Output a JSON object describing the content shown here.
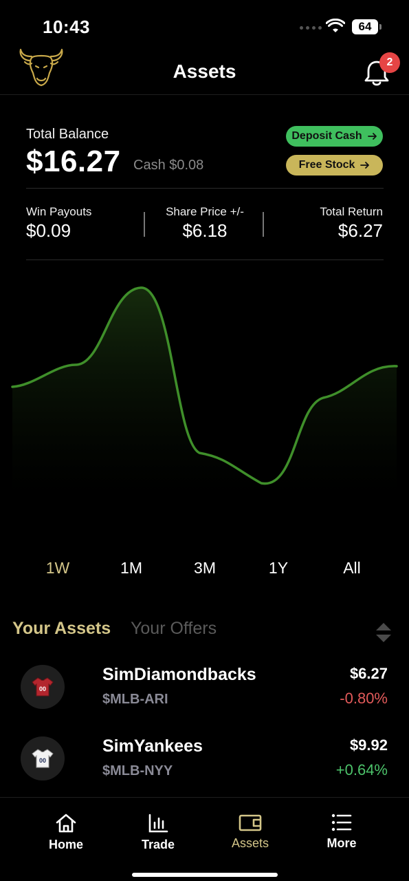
{
  "status_bar": {
    "time": "10:43",
    "battery": "64"
  },
  "header": {
    "title": "Assets",
    "notification_count": "2"
  },
  "balance": {
    "label": "Total Balance",
    "value": "$16.27",
    "cash": "Cash $0.08",
    "deposit_label": "Deposit Cash",
    "free_stock_label": "Free Stock"
  },
  "stats": [
    {
      "label": "Win Payouts",
      "value": "$0.09"
    },
    {
      "label": "Share Price +/-",
      "value": "$6.18"
    },
    {
      "label": "Total Return",
      "value": "$6.27"
    }
  ],
  "ranges": [
    "1W",
    "1M",
    "3M",
    "1Y",
    "All"
  ],
  "active_range": "1W",
  "tabs": {
    "assets": "Your Assets",
    "offers": "Your Offers"
  },
  "assets": [
    {
      "name": "SimDiamondbacks",
      "ticker": "$MLB-ARI",
      "price": "$6.27",
      "change": "-0.80%",
      "change_color": "#e25a5a",
      "jersey_color": "#b3262e",
      "jersey_number": "00"
    },
    {
      "name": "SimYankees",
      "ticker": "$MLB-NYY",
      "price": "$9.92",
      "change": "+0.64%",
      "change_color": "#4cc26a",
      "jersey_color": "#f2f2f2",
      "jersey_number": "00"
    }
  ],
  "nav": [
    {
      "label": "Home",
      "icon": "home-icon"
    },
    {
      "label": "Trade",
      "icon": "bar-chart-icon"
    },
    {
      "label": "Assets",
      "icon": "wallet-icon"
    },
    {
      "label": "More",
      "icon": "list-icon"
    }
  ],
  "colors": {
    "accent_gold": "#d4c689",
    "deposit_green": "#3fbf5e",
    "free_stock_gold": "#c9b65a",
    "chart_line": "#3f8f2a",
    "negative": "#e25a5a",
    "positive": "#4cc26a"
  }
}
